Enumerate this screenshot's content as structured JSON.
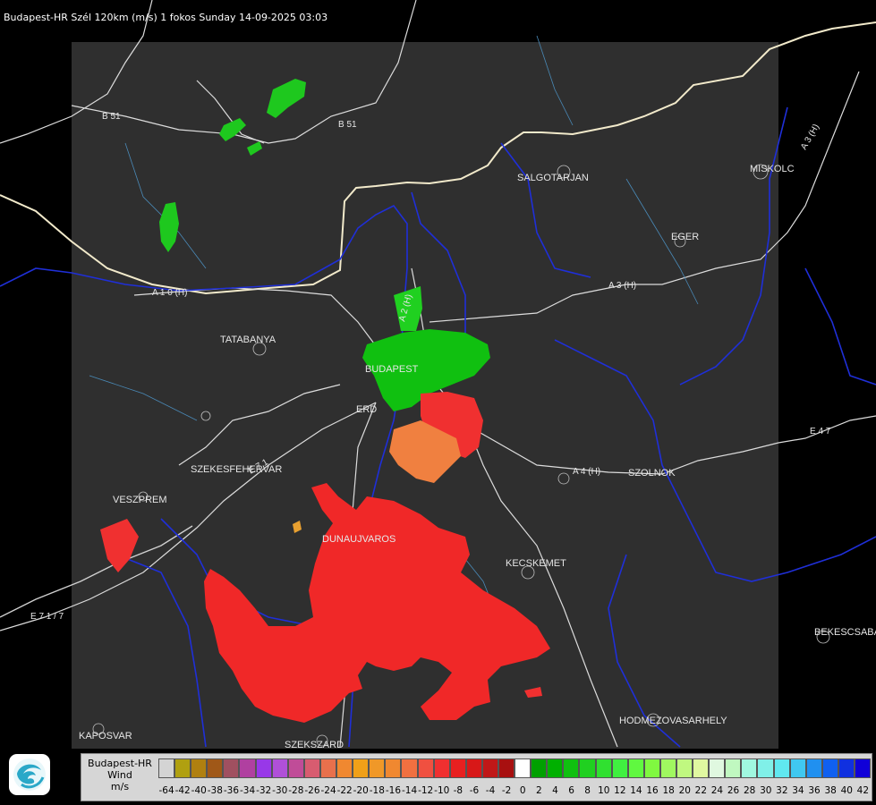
{
  "header": {
    "title": "Budapest-HR Szél 120km (m/s) 1 fokos Sunday 14-09-2025 03:03"
  },
  "map": {
    "city_labels": [
      "SALGOTARJAN",
      "MISKOLC",
      "EGER",
      "TATABANYA",
      "BUDAPEST",
      "ERD",
      "SZEKESFEHERVAR",
      "SZOLNOK",
      "VESZPREM",
      "DUNAUJVAROS",
      "KECSKEMET",
      "BEKESCSABA",
      "HODMEZOVASARHELY",
      "KAPOSVAR",
      "SZEKSZARD"
    ],
    "road_labels": [
      "B 51",
      "B 51",
      "A 3 (H)",
      "A 3 (H)",
      "A 1 0 (H)",
      "A 2 (H)",
      "A 4 (H)",
      "E 4 7",
      "E 7 1",
      "E 7 1 / 7"
    ],
    "colors": {
      "background": "#000000",
      "coverage": "#2f2f2f",
      "border": "#ffffff",
      "rivers": "#1f2fd8",
      "roads": "#d8d8d8"
    }
  },
  "legend": {
    "title_line1": "Budapest-HR",
    "title_line2": "Wind",
    "title_line3": "m/s",
    "scale_labels": [
      "-64",
      "-42",
      "-40",
      "-38",
      "-36",
      "-34",
      "-32",
      "-30",
      "-28",
      "-26",
      "-24",
      "-22",
      "-20",
      "-18",
      "-16",
      "-14",
      "-12",
      "-10",
      "-8",
      "-6",
      "-4",
      "-2",
      "0",
      "2",
      "4",
      "6",
      "8",
      "10",
      "12",
      "14",
      "16",
      "18",
      "20",
      "22",
      "24",
      "26",
      "28",
      "30",
      "32",
      "34",
      "36",
      "38",
      "40",
      "42"
    ],
    "colors": [
      "#d4d4d4",
      "#b0a010",
      "#b08010",
      "#a05818",
      "#a05060",
      "#b040a0",
      "#9838e8",
      "#b050d8",
      "#c04c98",
      "#d85c70",
      "#e8704c",
      "#f08830",
      "#f0a018",
      "#f09828",
      "#f08830",
      "#f07040",
      "#f05040",
      "#f03030",
      "#e82020",
      "#d81818",
      "#c01818",
      "#a81010",
      "#ffffff",
      "#00a000",
      "#00b000",
      "#10c010",
      "#20d020",
      "#30e030",
      "#40f040",
      "#60f840",
      "#80f840",
      "#a0f860",
      "#c0f880",
      "#e0f8a0",
      "#e0f8e0",
      "#c0f8c0",
      "#a0f8e0",
      "#80f0e8",
      "#60e8f0",
      "#40c8f0",
      "#2090f0",
      "#1060f0",
      "#1030e0",
      "#1000d8"
    ]
  }
}
